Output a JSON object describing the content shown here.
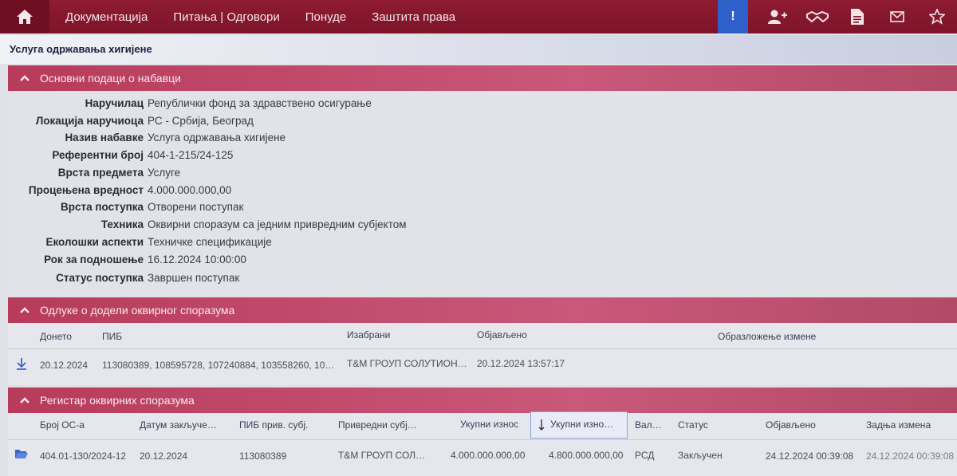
{
  "nav": {
    "items": [
      "Документација",
      "Питања | Одговори",
      "Понуде",
      "Заштита права"
    ],
    "alert_label": "!"
  },
  "page_title": "Услуга одржавања хигијене",
  "basic": {
    "header": "Основни подаци о набавци",
    "rows": [
      {
        "label": "Наручилац",
        "value": "Републички фонд за здравствено осигурање"
      },
      {
        "label": "Локација наручиоца",
        "value": "РС - Србија, Београд"
      },
      {
        "label": "Назив набавке",
        "value": "Услуга одржавања хигијене"
      },
      {
        "label": "Референтни број",
        "value": "404-1-215/24-125"
      },
      {
        "label": "Врста предмета",
        "value": "Услуге"
      },
      {
        "label": "Процењена вредност",
        "value": "4.000.000.000,00"
      },
      {
        "label": "Врста поступка",
        "value": "Отворени поступак"
      },
      {
        "label": "Техника",
        "value": "Оквирни споразум са једним привредним субјектом"
      },
      {
        "label": "Еколошки аспекти",
        "value": "Техничке спецификације"
      },
      {
        "label": "Рок за подношење",
        "value": "16.12.2024 10:00:00"
      },
      {
        "label": "Статус поступка",
        "value": "Завршен поступак"
      }
    ]
  },
  "decisions": {
    "header": "Одлуке о додели оквирног споразума",
    "columns": [
      "Донето",
      "ПИБ",
      "Изабрани",
      "Објављено",
      "Образложење измене"
    ],
    "rows": [
      {
        "date": "20.12.2024",
        "pib": "113080389, 108595728, 107240884, 103558260, 10…",
        "selected": "Т&М ГРОУП СОЛУТИОН…",
        "published": "20.12.2024 13:57:17",
        "reason": ""
      }
    ]
  },
  "registry": {
    "header": "Регистар оквирних споразума",
    "columns": [
      "Број ОС-а",
      "Датум закључе…",
      "ПИБ прив. субј.",
      "Привредни субј…",
      "Укупни износ",
      "Укупни изно…",
      "Вал…",
      "Статус",
      "Објављено",
      "Задња измена"
    ],
    "rows": [
      {
        "number": "404.01-130/2024-12",
        "date": "20.12.2024",
        "pib": "113080389",
        "company": "Т&М ГРОУП СОЛ…",
        "total1": "4.000.000.000,00",
        "total2": "4.800.000.000,00",
        "currency": "РСД",
        "status": "Закључен",
        "published": "24.12.2024 00:39:08",
        "last_change": "24.12.2024 00:39:08"
      }
    ]
  },
  "colors": {
    "nav_bg": "#7d1429",
    "panel_header": "#c9587a",
    "alert": "#2f5fc9"
  }
}
